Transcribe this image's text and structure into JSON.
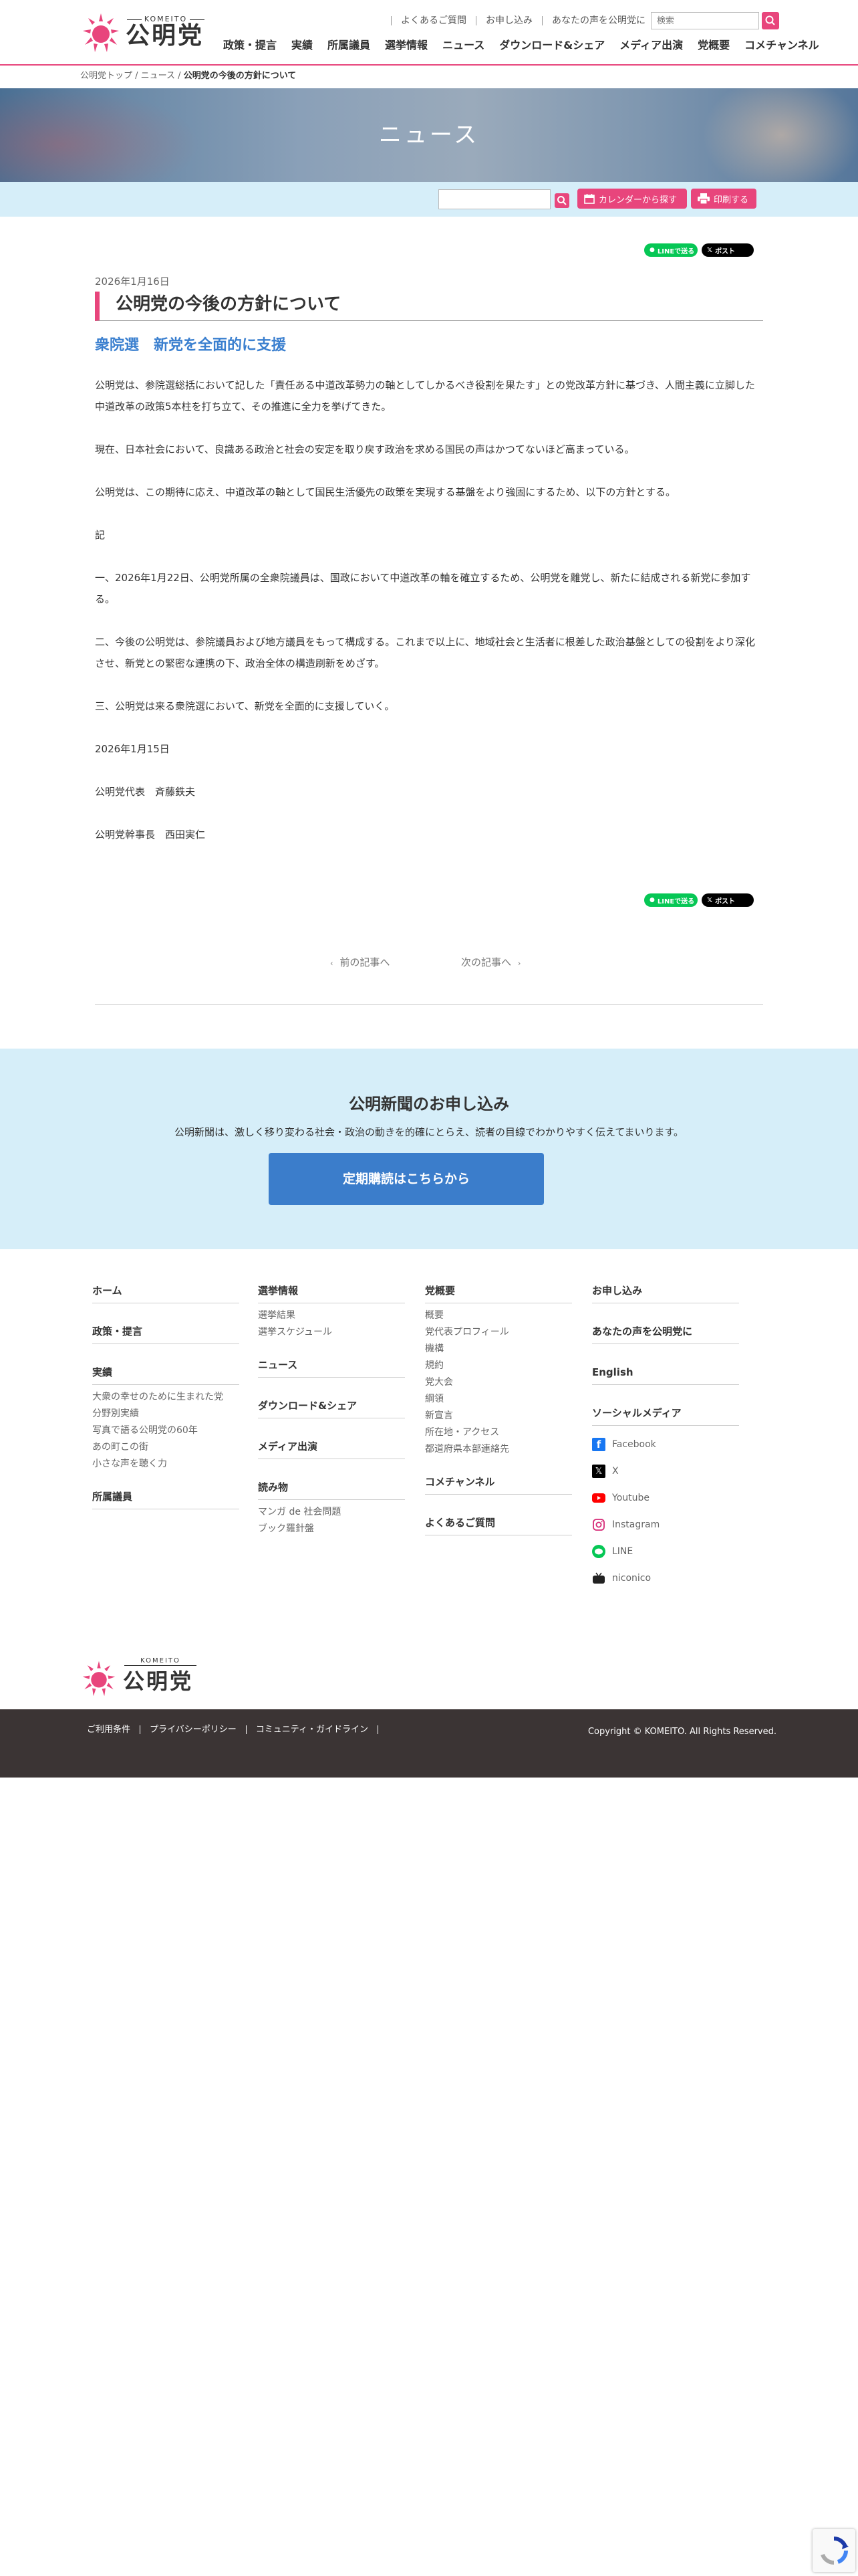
{
  "brand": {
    "en": "KOMEITO",
    "jp": "公明党",
    "color": "#e8457c"
  },
  "header": {
    "top_links": [
      "よくあるご質問",
      "お申し込み",
      "あなたの声を公明党に"
    ],
    "search_placeholder": "検索",
    "nav": [
      "政策・提言",
      "実績",
      "所属議員",
      "選挙情報",
      "ニュース",
      "ダウンロード&シェア",
      "メディア出演",
      "党概要",
      "コメチャンネル"
    ]
  },
  "breadcrumb": {
    "items": [
      "公明党トップ",
      "ニュース"
    ],
    "current": "公明党の今後の方針について"
  },
  "hero": {
    "title": "ニュース"
  },
  "toolbar": {
    "calendar_label": "カレンダーから探す",
    "print_label": "印刷する"
  },
  "share": {
    "line_label": "LINEで送る",
    "x_label": "ポスト"
  },
  "article": {
    "date": "2026年1月16日",
    "title": "公明党の今後の方針について",
    "subtitle": "衆院選　新党を全面的に支援",
    "p1": "公明党は、参院選総括において記した「責任ある中道改革勢力の軸としてしかるべき役割を果たす」との党改革方針に基づき、人間主義に立脚した中道改革の政策5本柱を打ち立て、その推進に全力を挙げてきた。",
    "p2": "現在、日本社会において、良識ある政治と社会の安定を取り戻す政治を求める国民の声はかつてないほど高まっている。",
    "p3": "公明党は、この期待に応え、中道改革の軸として国民生活優先の政策を実現する基盤をより強固にするため、以下の方針とする。",
    "p4": "記",
    "p5": "一、2026年1月22日、公明党所属の全衆院議員は、国政において中道改革の軸を確立するため、公明党を離党し、新たに結成される新党に参加する。",
    "p6": "二、今後の公明党は、参院議員および地方議員をもって構成する。これまで以上に、地域社会と生活者に根差した政治基盤としての役割をより深化させ、新党との緊密な連携の下、政治全体の構造刷新をめざす。",
    "p7": "三、公明党は来る衆院選において、新党を全面的に支援していく。",
    "p8": "2026年1月15日",
    "p9": "公明党代表　斉藤鉄夫",
    "p10": "公明党幹事長　西田実仁"
  },
  "pager": {
    "prev": "前の記事へ",
    "next": "次の記事へ"
  },
  "subscribe": {
    "heading": "公明新聞のお申し込み",
    "lead": "公明新聞は、激しく移り変わる社会・政治の動きを的確にとらえ、読者の目線でわかりやすく伝えてまいります。",
    "cta": "定期購読はこちらから"
  },
  "footer": {
    "col1": {
      "home": "ホーム",
      "policy": "政策・提言",
      "results": "実績",
      "results_items": [
        "大衆の幸せのために生まれた党",
        "分野別実績",
        "写真で語る公明党の60年",
        "あの町この街",
        "小さな声を聴く力"
      ],
      "members": "所属議員"
    },
    "col2": {
      "election": "選挙情報",
      "election_items": [
        "選挙結果",
        "選挙スケジュール"
      ],
      "news": "ニュース",
      "download": "ダウンロード&シェア",
      "media": "メディア出演",
      "reading": "読み物",
      "reading_items": [
        "マンガ de 社会問題",
        "ブック羅針盤"
      ]
    },
    "col3": {
      "about": "党概要",
      "about_items": [
        "概要",
        "党代表プロフィール",
        "機構",
        "規約",
        "党大会",
        "綱領",
        "新宣言",
        "所在地・アクセス",
        "都道府県本部連絡先"
      ],
      "channel": "コメチャンネル",
      "faq": "よくあるご質問"
    },
    "col4": {
      "apply": "お申し込み",
      "voice": "あなたの声を公明党に",
      "english": "English",
      "social_heading": "ソーシャルメディア",
      "social": [
        "Facebook",
        "X",
        "Youtube",
        "Instagram",
        "LINE",
        "niconico"
      ]
    },
    "bottom_links": [
      "ご利用条件",
      "プライバシーポリシー",
      "コミュニティ・ガイドライン"
    ],
    "copyright": "Copyright © KOMEITO. All Rights Reserved."
  }
}
